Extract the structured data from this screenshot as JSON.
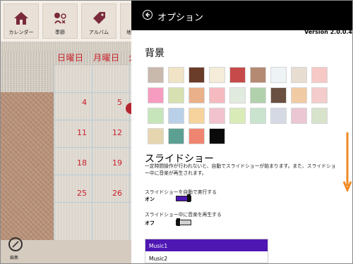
{
  "nav": {
    "items": [
      {
        "label": "カレンダー",
        "icon": "house-icon"
      },
      {
        "label": "季節",
        "icon": "seasons-icon"
      },
      {
        "label": "アルバム",
        "icon": "tag-icon"
      },
      {
        "label": "地"
      }
    ]
  },
  "calendar": {
    "day_headers": [
      "日曜日",
      "月曜日",
      "火"
    ],
    "sunday_dates": [
      "4",
      "11",
      "18",
      "25"
    ],
    "monday_dates": [
      "5",
      "12",
      "19",
      "26"
    ]
  },
  "bottom": {
    "edit_label": "編集",
    "edit_icon": "pencil-icon"
  },
  "options": {
    "title": "オプション",
    "back_icon": "back-arrow-icon",
    "version": "Version 2.0.0.4",
    "background_heading": "背景",
    "swatches": [
      "#c9b8ac",
      "#f1e4c6",
      "#6a3c2a",
      "#f4ecd9",
      "#c64a4a",
      "#b48a73",
      "#eef3f5",
      "#e7ddd0",
      "#f6c9c6",
      "#f59cc0",
      "#d7e0b0",
      "#e9b08a",
      "#f5b9c0",
      "#e1ebdf",
      "#b1d0ac",
      "#6a5040",
      "#f1cba3",
      "#f3cccb",
      "#c7e5ba",
      "#b9d0e8",
      "#f6d39c",
      "#f3c2cf",
      "#d9ecb8",
      "#c9e3cf",
      "#d5d9e3",
      "#ebc6d3",
      "#d8e3cc",
      "#e6d6b0",
      "#5ba092",
      "#ef8570",
      "#0a0a0a"
    ],
    "slideshow_heading": "スライドショー",
    "slideshow_desc": "一定時間操作が行われないと、自動でスライドショーが始まります。また、スライドショー中に音楽が再生されます。",
    "auto_run_label": "スライドショーを自動で実行する",
    "auto_run_state": "オン",
    "music_label": "スライドショー中に音楽を再生する",
    "music_state": "オフ",
    "music_list": [
      "Music1",
      "Music2"
    ],
    "accent_color": "#4e17b3",
    "scroll_hint_color": "#f08a24"
  }
}
